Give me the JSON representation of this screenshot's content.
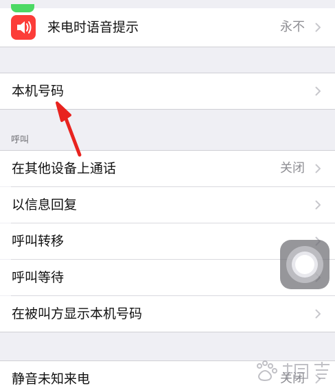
{
  "rows": {
    "voice_announce": {
      "label": "来电时语音提示",
      "value": "永不"
    },
    "my_number": {
      "label": "本机号码"
    },
    "other_devices": {
      "label": "在其他设备上通话",
      "value": "关闭"
    },
    "reply_message": {
      "label": "以信息回复"
    },
    "call_forwarding": {
      "label": "呼叫转移"
    },
    "call_waiting": {
      "label": "呼叫等待"
    },
    "show_caller_id": {
      "label": "在被叫方显示本机号码"
    },
    "silence_unknown": {
      "label": "静音未知来电",
      "value": "关闭"
    }
  },
  "section_calls": {
    "header": "呼叫"
  },
  "icons": {
    "voice_announce": "speaker-icon",
    "chevron": "chevron-right-icon",
    "assistive_touch": "assistive-touch-icon",
    "watermark": "baidu-jingyan-watermark"
  },
  "colors": {
    "background": "#efeff4",
    "cell": "#ffffff",
    "secondary_text": "#8e8e93",
    "chevron": "#c7c7cc",
    "speaker_icon_bg": "#fc3d39",
    "annotation_arrow": "#e8231f"
  },
  "annotation": {
    "type": "arrow",
    "points_to": "本机号码"
  }
}
